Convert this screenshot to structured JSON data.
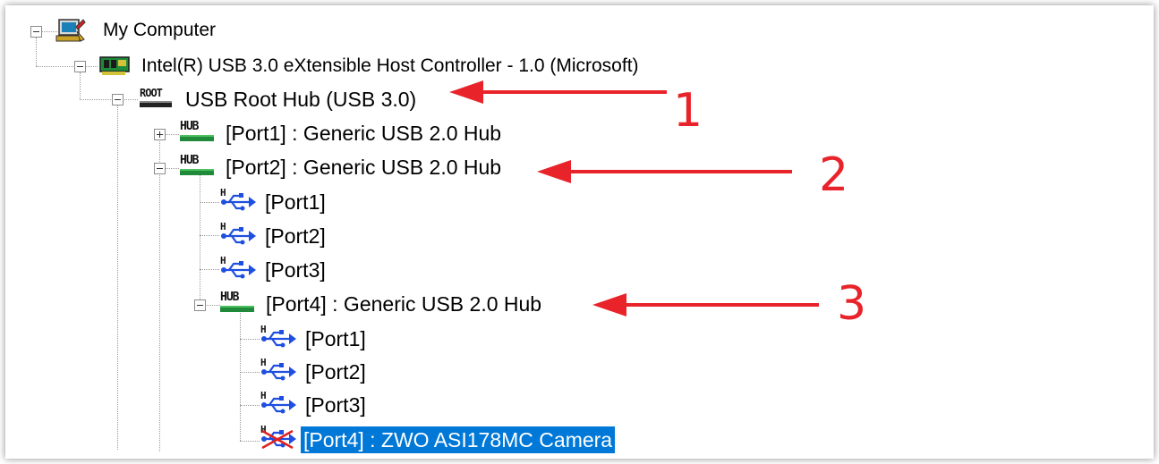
{
  "tree": {
    "nodes": [
      {
        "label": "My Computer",
        "icon": "computer-icon"
      },
      {
        "label": "Intel(R) USB 3.0 eXtensible Host Controller - 1.0 (Microsoft)",
        "icon": "controller-card-icon"
      },
      {
        "label": "USB Root Hub (USB 3.0)",
        "icon": "root-hub-icon",
        "badge": "ROOT"
      },
      {
        "label": "[Port1] : Generic USB 2.0 Hub",
        "icon": "hub-icon",
        "badge": "HUB",
        "collapsed": true
      },
      {
        "label": "[Port2] : Generic USB 2.0 Hub",
        "icon": "hub-icon",
        "badge": "HUB"
      },
      {
        "label": "[Port1]",
        "icon": "usb-port-icon"
      },
      {
        "label": "[Port2]",
        "icon": "usb-port-icon"
      },
      {
        "label": "[Port3]",
        "icon": "usb-port-icon"
      },
      {
        "label": "[Port4] : Generic USB 2.0 Hub",
        "icon": "hub-icon",
        "badge": "HUB"
      },
      {
        "label": "[Port1]",
        "icon": "usb-port-icon"
      },
      {
        "label": "[Port2]",
        "icon": "usb-port-icon"
      },
      {
        "label": "[Port3]",
        "icon": "usb-port-icon"
      },
      {
        "label": "[Port4] : ZWO ASI178MC Camera",
        "icon": "usb-device-icon",
        "selected": true
      }
    ]
  },
  "annotations": [
    {
      "number": "1"
    },
    {
      "number": "2"
    },
    {
      "number": "3"
    }
  ],
  "colors": {
    "selection": "#0078d7",
    "arrow": "#e8232a",
    "usb_icon": "#1f4fe0"
  }
}
